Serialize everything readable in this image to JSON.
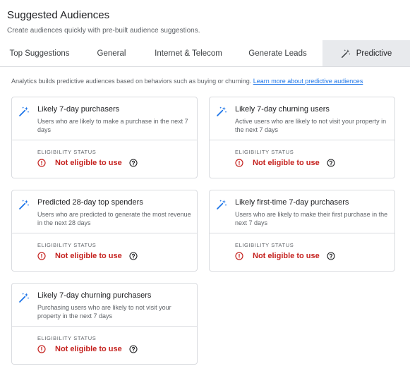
{
  "header": {
    "title": "Suggested Audiences",
    "subtitle": "Create audiences quickly with pre-built audience suggestions."
  },
  "tabs": [
    {
      "label": "Top Suggestions"
    },
    {
      "label": "General"
    },
    {
      "label": "Internet & Telecom"
    },
    {
      "label": "Generate Leads"
    },
    {
      "label": "Predictive",
      "active": true,
      "icon": "magic-wand-icon"
    }
  ],
  "intro": {
    "text": "Analytics builds predictive audiences based on behaviors such as buying or churning.",
    "link": "Learn more about predictive audiences"
  },
  "colors": {
    "accent": "#1a73e8",
    "error": "#c5221f",
    "tab_active_bg": "#e8eaed"
  },
  "cards": [
    {
      "title": "Likely 7-day purchasers",
      "description": "Users who are likely to make a purchase in the next 7 days",
      "eligibility_label": "ELIGIBILITY STATUS",
      "status": "Not eligible to use"
    },
    {
      "title": "Likely 7-day churning users",
      "description": "Active users who are likely to not visit your property in the next 7 days",
      "eligibility_label": "ELIGIBILITY STATUS",
      "status": "Not eligible to use"
    },
    {
      "title": "Predicted 28-day top spenders",
      "description": "Users who are predicted to generate the most revenue in the next 28 days",
      "eligibility_label": "ELIGIBILITY STATUS",
      "status": "Not eligible to use"
    },
    {
      "title": "Likely first-time 7-day purchasers",
      "description": "Users who are likely to make their first purchase in the next 7 days",
      "eligibility_label": "ELIGIBILITY STATUS",
      "status": "Not eligible to use"
    },
    {
      "title": "Likely 7-day churning purchasers",
      "description": "Purchasing users who are likely to not visit your property in the next 7 days",
      "eligibility_label": "ELIGIBILITY STATUS",
      "status": "Not eligible to use"
    }
  ]
}
